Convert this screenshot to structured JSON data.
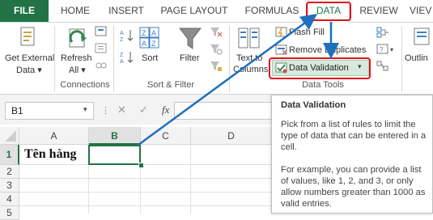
{
  "tabs": {
    "file": "FILE",
    "home": "HOME",
    "insert": "INSERT",
    "page_layout": "PAGE LAYOUT",
    "formulas": "FORMULAS",
    "data": "DATA",
    "review": "REVIEW",
    "view_partial": "VIEV"
  },
  "ribbon": {
    "get_external_data_line1": "Get External",
    "get_external_data_line2": "Data ▾",
    "refresh_all_line1": "Refresh",
    "refresh_all_line2": "All ▾",
    "connections_group": "Connections",
    "sort": "Sort",
    "filter": "Filter",
    "sort_filter_group": "Sort & Filter",
    "text_to_columns_line1": "Text to",
    "text_to_columns_line2": "Columns",
    "flash_fill": "Flash Fill",
    "remove_duplicates": "Remove Duplicates",
    "data_validation": "Data Validation",
    "data_tools_group": "Data Tools",
    "outline_partial": "Outlin"
  },
  "formula_bar": {
    "name_box": "B1",
    "cancel_symbol": "✕",
    "enter_symbol": "✓",
    "fx_symbol": "fx",
    "value": ""
  },
  "grid": {
    "columns": [
      "A",
      "B",
      "C",
      "D"
    ],
    "rows": [
      "1",
      "2",
      "3",
      "4",
      "5"
    ],
    "a1_value": "Tên hàng",
    "selected_cell": "B1"
  },
  "tooltip": {
    "title": "Data Validation",
    "lines1": [
      "Pick from a list of rules to limit the",
      "type of data that can be entered in a",
      "cell."
    ],
    "lines2": [
      "For example, you can provide a list",
      "of values, like 1, 2, and 3, or only",
      "allow numbers greater than 1000 as",
      "valid entries."
    ]
  },
  "colors": {
    "excel_green": "#217346",
    "annotation_red": "#e0131b",
    "arrow_blue": "#1f6fbf"
  }
}
